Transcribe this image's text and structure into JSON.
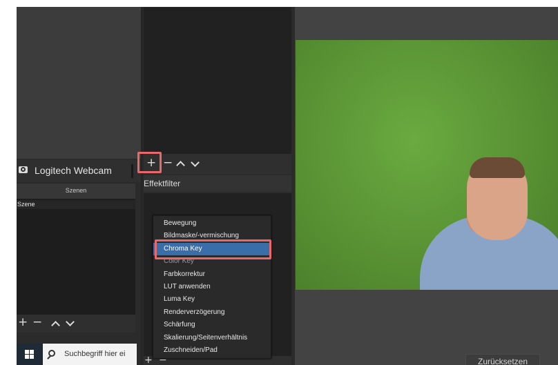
{
  "source": {
    "name": "Logitech Webcam"
  },
  "scenes": {
    "header": "Szenen",
    "items": [
      "Szene"
    ]
  },
  "filters": {
    "title": "Effektfilter"
  },
  "controls": {
    "add": "+",
    "remove": "−"
  },
  "add_menu": {
    "items": [
      {
        "label": "Bewegung"
      },
      {
        "label": "Bildmaske/-vermischung"
      },
      {
        "label": "Chroma Key",
        "selected": true
      },
      {
        "label": "Color Key"
      },
      {
        "label": "Farbkorrektur"
      },
      {
        "label": "LUT anwenden"
      },
      {
        "label": "Luma Key"
      },
      {
        "label": "Renderverzögerung"
      },
      {
        "label": "Schärfung"
      },
      {
        "label": "Skalierung/Seitenverhältnis"
      },
      {
        "label": "Zuschneiden/Pad"
      }
    ]
  },
  "footer": {
    "reset_label": "Zurücksetzen"
  },
  "taskbar": {
    "search_placeholder": "Suchbegriff hier ei"
  },
  "colors": {
    "green_screen": "#5e9a38",
    "highlight": "#e8696c",
    "selection": "#3a6ea8"
  }
}
